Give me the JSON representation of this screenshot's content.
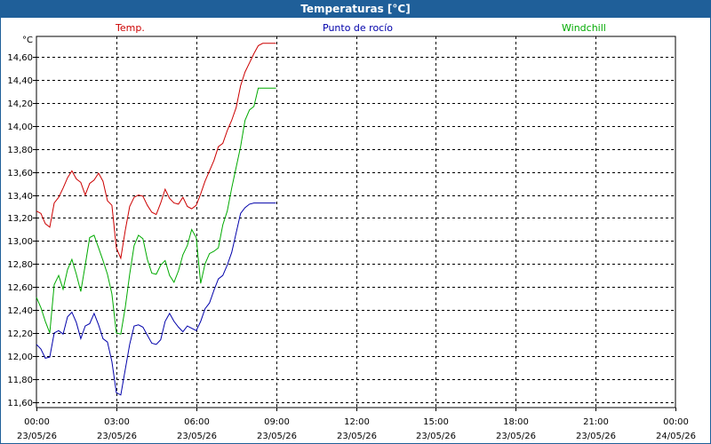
{
  "window": {
    "title": "Temperaturas [°C]"
  },
  "chart_data": {
    "type": "line",
    "title": "Temperaturas [°C]",
    "y_unit": "°C",
    "ylim": [
      11.55,
      14.78
    ],
    "y_ticks": [
      "11,60",
      "11,80",
      "12,00",
      "12,20",
      "12,40",
      "12,60",
      "12,80",
      "13,00",
      "13,20",
      "13,40",
      "13,60",
      "13,80",
      "14,00",
      "14,20",
      "14,40",
      "14,60"
    ],
    "y_tick_values": [
      11.6,
      11.8,
      12.0,
      12.2,
      12.4,
      12.6,
      12.8,
      13.0,
      13.2,
      13.4,
      13.6,
      13.8,
      14.0,
      14.2,
      14.4,
      14.6
    ],
    "xlim": [
      0,
      24
    ],
    "x_tick_values": [
      0,
      3,
      6,
      9,
      12,
      15,
      18,
      21,
      24
    ],
    "x_ticks": [
      {
        "time": "00:00",
        "date": "23/05/26"
      },
      {
        "time": "03:00",
        "date": "23/05/26"
      },
      {
        "time": "06:00",
        "date": "23/05/26"
      },
      {
        "time": "09:00",
        "date": "23/05/26"
      },
      {
        "time": "12:00",
        "date": "23/05/26"
      },
      {
        "time": "15:00",
        "date": "23/05/26"
      },
      {
        "time": "18:00",
        "date": "23/05/26"
      },
      {
        "time": "21:00",
        "date": "23/05/26"
      },
      {
        "time": "00:00",
        "date": "24/05/26"
      }
    ],
    "grid": true,
    "legend_placement": "top",
    "x": [
      0,
      0.167,
      0.333,
      0.5,
      0.667,
      0.833,
      1.0,
      1.167,
      1.333,
      1.5,
      1.667,
      1.833,
      2.0,
      2.167,
      2.333,
      2.5,
      2.667,
      2.833,
      3.0,
      3.167,
      3.333,
      3.5,
      3.667,
      3.833,
      4.0,
      4.167,
      4.333,
      4.5,
      4.667,
      4.833,
      5.0,
      5.167,
      5.333,
      5.5,
      5.667,
      5.833,
      6.0,
      6.167,
      6.333,
      6.5,
      6.667,
      6.833,
      7.0,
      7.167,
      7.333,
      7.5,
      7.667,
      7.833,
      8.0,
      8.167,
      8.333,
      8.5,
      8.667,
      8.833,
      9.0
    ],
    "series": [
      {
        "name": "Temp.",
        "color": "#cc0000",
        "values": [
          13.26,
          13.24,
          13.15,
          13.12,
          13.33,
          13.38,
          13.46,
          13.55,
          13.61,
          13.54,
          13.51,
          13.4,
          13.5,
          13.53,
          13.59,
          13.52,
          13.35,
          13.31,
          12.94,
          12.85,
          13.09,
          13.3,
          13.38,
          13.4,
          13.39,
          13.31,
          13.25,
          13.23,
          13.33,
          13.45,
          13.37,
          13.33,
          13.32,
          13.38,
          13.3,
          13.28,
          13.31,
          13.41,
          13.52,
          13.61,
          13.7,
          13.82,
          13.85,
          13.96,
          14.05,
          14.16,
          14.35,
          14.47,
          14.55,
          14.63,
          14.7,
          14.72,
          14.72,
          14.72,
          14.72
        ]
      },
      {
        "name": "Punto de rocío",
        "color": "#0000aa",
        "values": [
          12.1,
          12.06,
          11.98,
          11.99,
          12.2,
          12.22,
          12.19,
          12.34,
          12.38,
          12.29,
          12.15,
          12.26,
          12.28,
          12.37,
          12.27,
          12.15,
          12.12,
          11.95,
          11.68,
          11.66,
          11.88,
          12.1,
          12.26,
          12.27,
          12.25,
          12.18,
          12.11,
          12.1,
          12.14,
          12.3,
          12.37,
          12.3,
          12.25,
          12.21,
          12.26,
          12.24,
          12.22,
          12.3,
          12.41,
          12.46,
          12.57,
          12.67,
          12.7,
          12.79,
          12.9,
          13.07,
          13.24,
          13.29,
          13.32,
          13.33,
          13.33,
          13.33,
          13.33,
          13.33,
          13.33
        ]
      },
      {
        "name": "Windchill",
        "color": "#00aa00",
        "values": [
          12.51,
          12.42,
          12.3,
          12.2,
          12.62,
          12.7,
          12.58,
          12.75,
          12.84,
          12.71,
          12.56,
          12.79,
          13.03,
          13.05,
          12.94,
          12.83,
          12.71,
          12.54,
          12.2,
          12.19,
          12.42,
          12.71,
          12.96,
          13.05,
          13.02,
          12.84,
          12.72,
          12.71,
          12.79,
          12.83,
          12.7,
          12.64,
          12.74,
          12.88,
          12.96,
          13.1,
          13.03,
          12.63,
          12.8,
          12.89,
          12.91,
          12.94,
          13.14,
          13.26,
          13.46,
          13.64,
          13.82,
          14.05,
          14.14,
          14.17,
          14.33,
          14.33,
          14.33,
          14.33,
          14.33
        ]
      }
    ]
  }
}
